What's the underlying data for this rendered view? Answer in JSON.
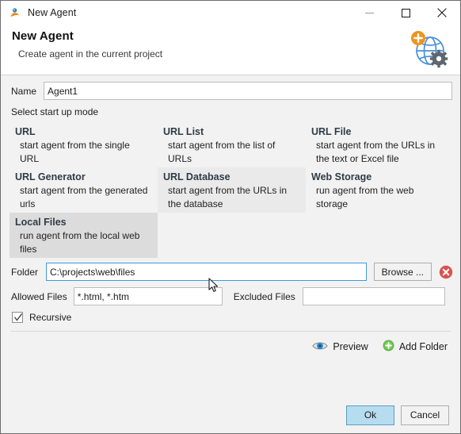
{
  "window": {
    "title": "New Agent",
    "app_icon": "agent-person-icon",
    "controls": {
      "minimize": "minimize-icon",
      "maximize": "maximize-icon",
      "close": "close-icon"
    }
  },
  "header": {
    "title": "New Agent",
    "subtitle": "Create agent in the current project",
    "icon": "globe-add-gear-icon"
  },
  "form": {
    "name_label": "Name",
    "name_value": "Agent1",
    "name_placeholder": "",
    "mode_label": "Select start up mode"
  },
  "modes": [
    {
      "title": "URL",
      "desc": "start agent from the single URL",
      "state": "normal"
    },
    {
      "title": "URL List",
      "desc": "start agent from the list of URLs",
      "state": "normal"
    },
    {
      "title": "URL File",
      "desc": "start agent from the URLs in the text or Excel file",
      "state": "normal"
    },
    {
      "title": "URL Generator",
      "desc": "start agent from the generated urls",
      "state": "normal"
    },
    {
      "title": "URL Database",
      "desc": "start agent from the URLs in the database",
      "state": "hover"
    },
    {
      "title": "Web Storage",
      "desc": "run agent from the web storage",
      "state": "normal"
    },
    {
      "title": "Local Files",
      "desc": "run agent from the local web files",
      "state": "selected"
    }
  ],
  "folder": {
    "label": "Folder",
    "value": "C:\\projects\\web\\files",
    "placeholder": "",
    "browse_label": "Browse ...",
    "delete_icon": "delete-circle-icon"
  },
  "filters": {
    "allowed_label": "Allowed Files",
    "allowed_value": "*.html, *.htm",
    "allowed_placeholder": "",
    "excluded_label": "Excluded Files",
    "excluded_value": "",
    "excluded_placeholder": ""
  },
  "recursive": {
    "label": "Recursive",
    "checked": "true"
  },
  "actions": {
    "preview_label": "Preview",
    "preview_icon": "eye-icon",
    "add_folder_label": "Add Folder",
    "add_folder_icon": "plus-circle-icon"
  },
  "footer": {
    "ok_label": "Ok",
    "cancel_label": "Cancel"
  },
  "colors": {
    "accent_blue": "#3f9bd8",
    "default_button_fill": "#b6dcf0",
    "selected_cell": "#dcdcdc",
    "hover_cell": "#eaeaea",
    "heading_text": "#2f3b46",
    "delete_red": "#d9534f",
    "add_green": "#5cb85c",
    "badge_orange": "#f0941e"
  }
}
